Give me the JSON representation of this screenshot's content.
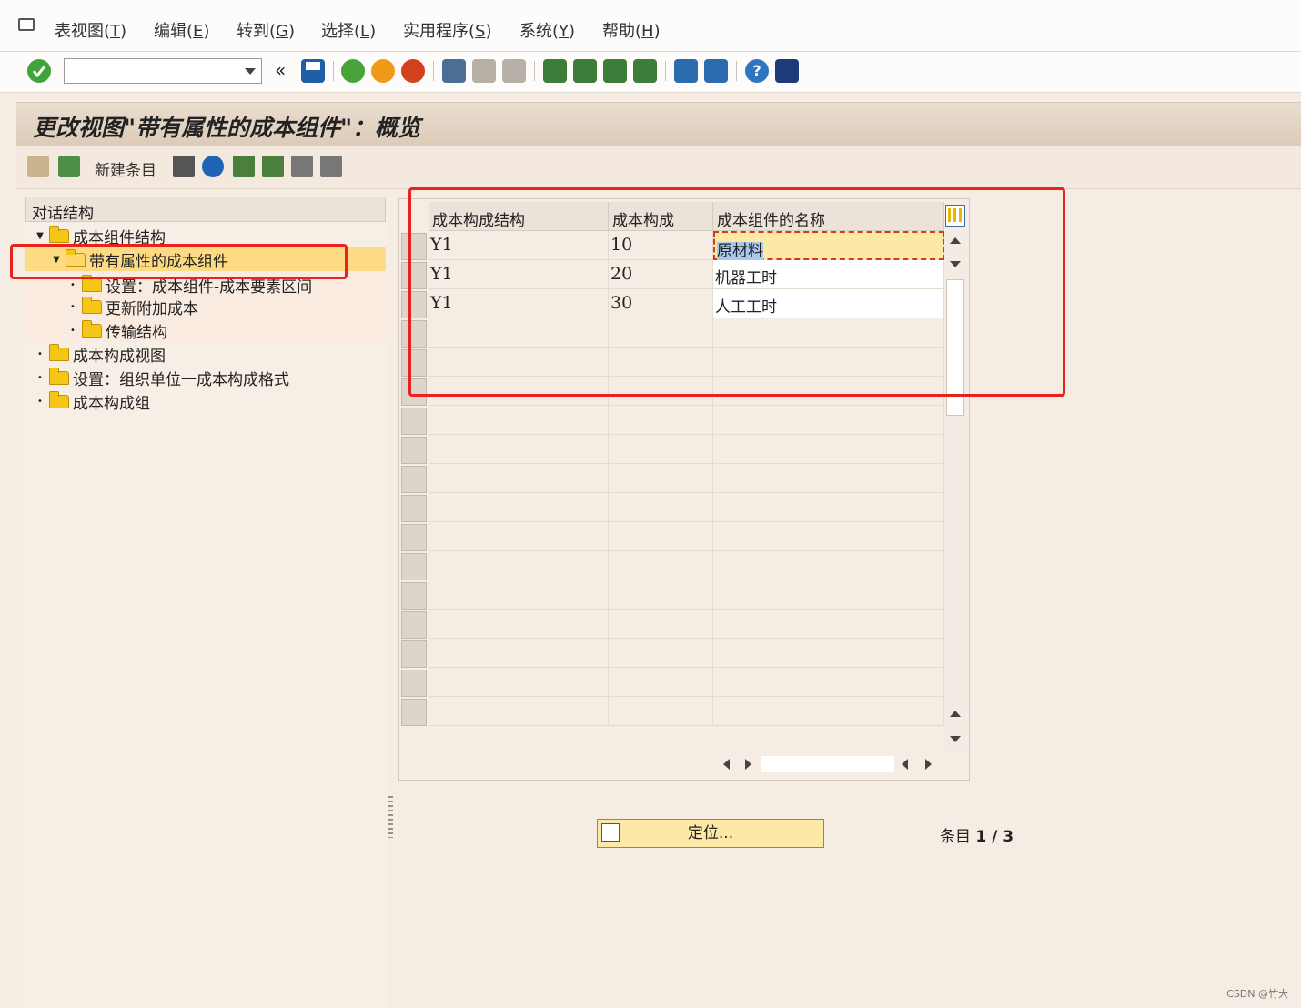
{
  "menu": {
    "items": [
      {
        "label": "表视图(",
        "key": "T",
        "end": ")"
      },
      {
        "label": "编辑(",
        "key": "E",
        "end": ")"
      },
      {
        "label": "转到(",
        "key": "G",
        "end": ")"
      },
      {
        "label": "选择(",
        "key": "L",
        "end": ")"
      },
      {
        "label": "实用程序(",
        "key": "S",
        "end": ")"
      },
      {
        "label": "系统(",
        "key": "Y",
        "end": ")"
      },
      {
        "label": "帮助(",
        "key": "H",
        "end": ")"
      }
    ]
  },
  "toolbar": {
    "command_value": "",
    "back_glyph": "«"
  },
  "title": "更改视图\"带有属性的成本组件\"：概览",
  "app_toolbar": {
    "new_entries_label": "新建条目"
  },
  "tree": {
    "header": "对话结构",
    "nodes": [
      {
        "label": "成本组件结构",
        "level": 0,
        "expanded": true
      },
      {
        "label": "带有属性的成本组件",
        "level": 1,
        "expanded": true,
        "selected": true
      },
      {
        "label": "设置：成本组件-成本要素区间",
        "level": 2
      },
      {
        "label": "更新附加成本",
        "level": 2
      },
      {
        "label": "传输结构",
        "level": 2
      },
      {
        "label": "成本构成视图",
        "level": 0
      },
      {
        "label": "设置：组织单位一成本构成格式",
        "level": 0
      },
      {
        "label": "成本构成组",
        "level": 0
      }
    ]
  },
  "table": {
    "columns": [
      "成本构成结构",
      "成本构成",
      "成本组件的名称"
    ],
    "rows": [
      [
        "Y1",
        "10",
        "原材料"
      ],
      [
        "Y1",
        "20",
        "机器工时"
      ],
      [
        "Y1",
        "30",
        "人工工时"
      ]
    ],
    "selected_cell": "原材料"
  },
  "footer": {
    "locate_label": "定位...",
    "entry_label": "条目",
    "entry_value": "1 / 3"
  },
  "watermark": "CSDN @竹大",
  "colors": {
    "annotation_red": "#e8231e",
    "selection_yellow": "#fce9a5",
    "highlight_blue": "#a9c8ee"
  }
}
